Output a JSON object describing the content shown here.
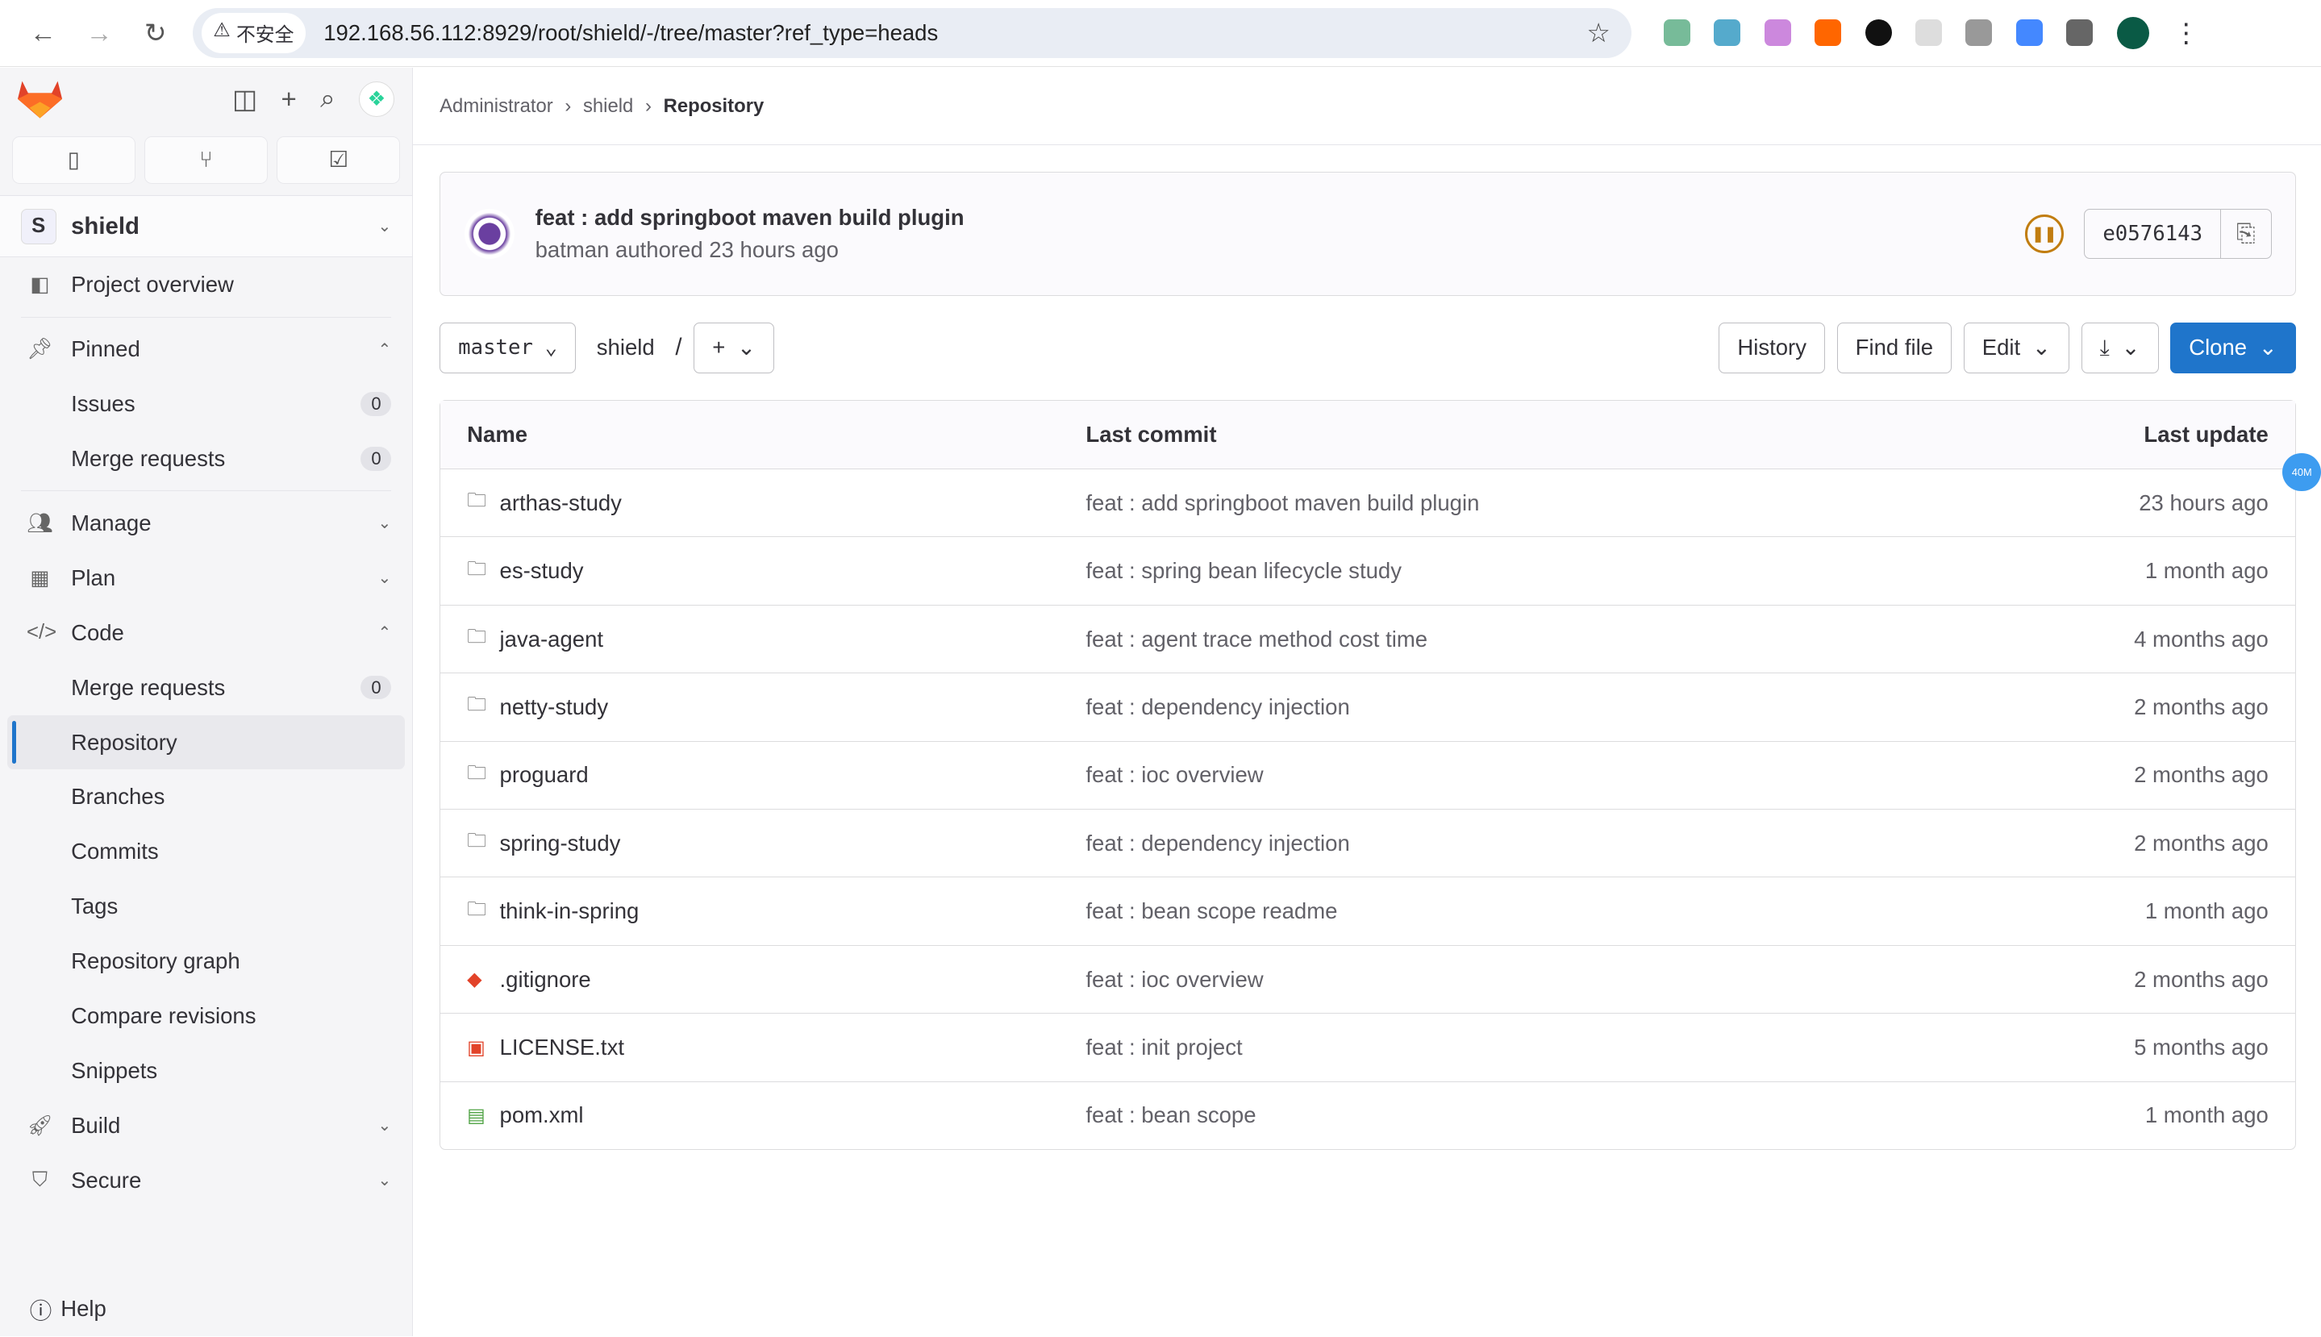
{
  "browser": {
    "security": "不安全",
    "url": "192.168.56.112:8929/root/shield/-/tree/master?ref_type=heads"
  },
  "sidebar": {
    "project_initial": "S",
    "project": "shield",
    "items": [
      {
        "label": "Project overview",
        "icon": "overview-icon"
      },
      {
        "label": "Pinned",
        "icon": "pin-icon"
      },
      {
        "label": "Issues",
        "badge": "0"
      },
      {
        "label": "Merge requests",
        "badge": "0"
      },
      {
        "label": "Manage",
        "icon": "users-icon"
      },
      {
        "label": "Plan",
        "icon": "calendar-icon"
      },
      {
        "label": "Code",
        "icon": "code-icon"
      },
      {
        "label": "Merge requests",
        "badge": "0"
      },
      {
        "label": "Repository"
      },
      {
        "label": "Branches"
      },
      {
        "label": "Commits"
      },
      {
        "label": "Tags"
      },
      {
        "label": "Repository graph"
      },
      {
        "label": "Compare revisions"
      },
      {
        "label": "Snippets"
      },
      {
        "label": "Build",
        "icon": "rocket-icon"
      },
      {
        "label": "Secure",
        "icon": "shield-icon"
      }
    ],
    "help": "Help"
  },
  "breadcrumb": [
    "Administrator",
    "shield",
    "Repository"
  ],
  "commit": {
    "title": "feat : add springboot maven build plugin",
    "author": "batman",
    "meta": "authored 23 hours ago",
    "pipeline_status": "paused",
    "sha": "e0576143"
  },
  "toolbar": {
    "branch": "master",
    "path": "shield",
    "sep": "/",
    "history": "History",
    "find_file": "Find file",
    "edit": "Edit",
    "clone": "Clone"
  },
  "table": {
    "headers": [
      "Name",
      "Last commit",
      "Last update"
    ],
    "rows": [
      {
        "name": "arthas-study",
        "type": "folder",
        "commit": "feat : add springboot maven build plugin",
        "updated": "23 hours ago"
      },
      {
        "name": "es-study",
        "type": "folder",
        "commit": "feat : spring bean lifecycle study",
        "updated": "1 month ago"
      },
      {
        "name": "java-agent",
        "type": "folder",
        "commit": "feat : agent trace method cost time",
        "updated": "4 months ago"
      },
      {
        "name": "netty-study",
        "type": "folder",
        "commit": "feat : dependency injection",
        "updated": "2 months ago"
      },
      {
        "name": "proguard",
        "type": "folder",
        "commit": "feat : ioc overview",
        "updated": "2 months ago"
      },
      {
        "name": "spring-study",
        "type": "folder",
        "commit": "feat : dependency injection",
        "updated": "2 months ago"
      },
      {
        "name": "think-in-spring",
        "type": "folder",
        "commit": "feat : bean scope readme",
        "updated": "1 month ago"
      },
      {
        "name": ".gitignore",
        "type": "git",
        "commit": "feat : ioc overview",
        "updated": "2 months ago"
      },
      {
        "name": "LICENSE.txt",
        "type": "license",
        "commit": "feat : init project",
        "updated": "5 months ago"
      },
      {
        "name": "pom.xml",
        "type": "xml",
        "commit": "feat : bean scope",
        "updated": "1 month ago"
      }
    ]
  },
  "float_badge": "40M",
  "colors": {
    "accent": "#1f75cb",
    "pipeline": "#c17d10"
  }
}
